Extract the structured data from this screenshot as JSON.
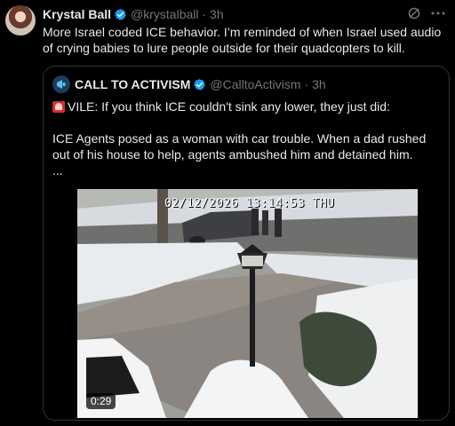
{
  "post": {
    "author_name": "Krystal Ball",
    "author_handle": "@krystalball",
    "time": "· 3h",
    "text": "More Israel coded ICE behavior. I’m reminded of when Israel used audio of crying babies to lure people outside for their quadcopters to kill."
  },
  "quote": {
    "author_name": "CALL TO ACTIVISM",
    "author_handle": "@CalltoActivism",
    "time": "· 3h",
    "line1": "VILE: If you think ICE couldn't sink any lower, they just did:",
    "line2": "ICE Agents posed as a woman with car trouble. When a dad rushed out of his house to help, agents ambushed him and detained him.",
    "line3": "...",
    "video": {
      "overlay_timestamp": "02/12/2026 13:14:53 THU",
      "duration": "0:29"
    }
  },
  "icons": {
    "verified": "verified-badge-icon",
    "grok": "grok-icon",
    "more": "more-options-icon",
    "siren": "rotating-light-icon"
  },
  "colors": {
    "background": "#000000",
    "text": "#e7e9ea",
    "muted": "#71767b",
    "verified": "#1d9bf0",
    "border": "#2f3336"
  }
}
